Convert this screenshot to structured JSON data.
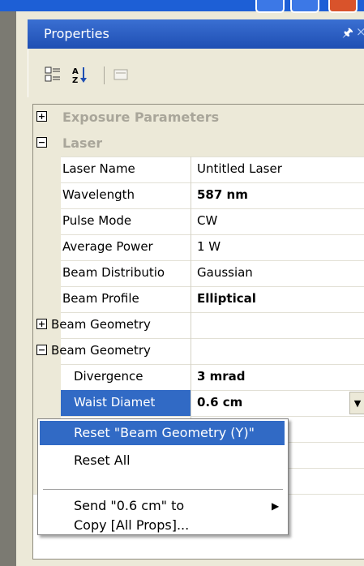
{
  "window": {
    "title": "Properties"
  },
  "toolbar": {
    "categorized_icon": "categorized-icon",
    "alphabetical_icon": "alphabetical-icon",
    "pages_icon": "property-pages-icon"
  },
  "grid": {
    "categories": [
      {
        "label": "Exposure Parameters",
        "expanded": false
      },
      {
        "label": "Laser",
        "expanded": true
      }
    ],
    "properties": [
      {
        "name": "Laser Name",
        "value": "Untitled Laser"
      },
      {
        "name": "Wavelength",
        "value": "587 nm"
      },
      {
        "name": "Pulse Mode",
        "value": "CW"
      },
      {
        "name": "Average Power",
        "value": "1 W"
      },
      {
        "name": "Beam Distributio",
        "value": "Gaussian"
      },
      {
        "name": "Beam Profile",
        "value": "Elliptical"
      },
      {
        "name": "Beam Geometry",
        "value": ""
      },
      {
        "name": "Beam Geometry",
        "value": ""
      },
      {
        "name": "Divergence",
        "value": "3 mrad"
      },
      {
        "name": "Waist Diamet",
        "value": "0.6 cm"
      }
    ]
  },
  "context_menu": {
    "items": [
      "Reset \"Beam Geometry (Y)\"",
      "Reset All",
      "Send \"0.6 cm\" to",
      "Copy [All Props]..."
    ]
  },
  "colors": {
    "selection": "#316ac5",
    "titlebar": "#2557b7"
  }
}
